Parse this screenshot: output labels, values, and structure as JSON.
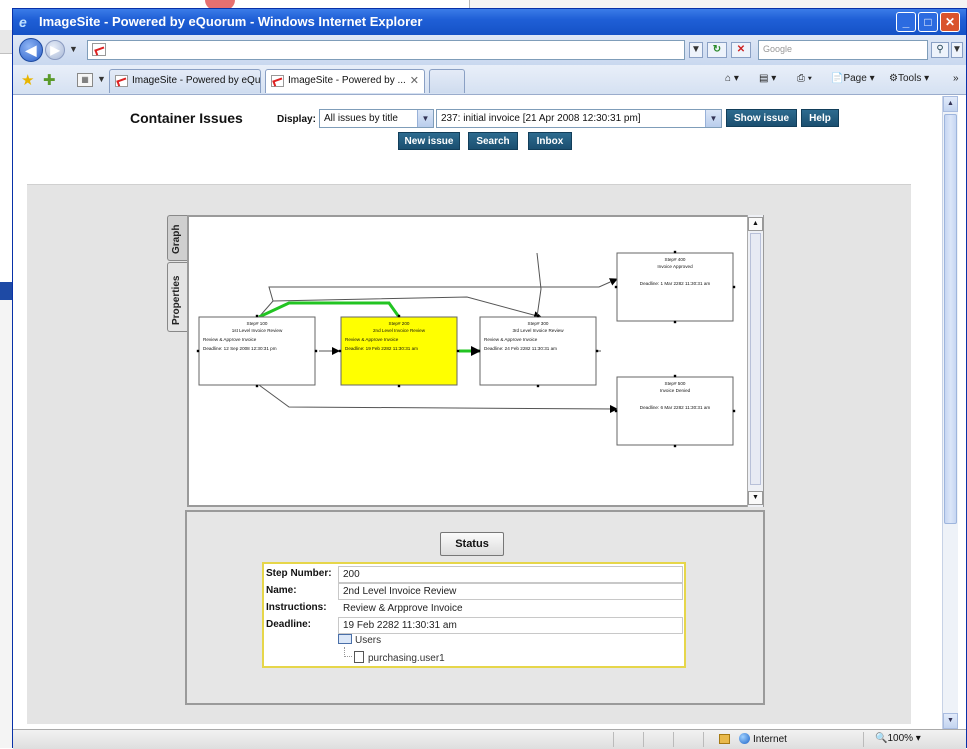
{
  "window": {
    "title": "ImageSite - Powered by eQuorum - Windows Internet Explorer"
  },
  "browser": {
    "search_placeholder": "Google",
    "tabs": [
      {
        "label": "ImageSite - Powered by eQu..."
      },
      {
        "label": "ImageSite - Powered by ..."
      }
    ],
    "tools": {
      "page_label": "Page",
      "tools_label": "Tools"
    }
  },
  "page": {
    "title": "Container Issues",
    "display_label": "Display:",
    "display_select": "All issues by title",
    "issue_select": "237:  initial invoice    [21 Apr 2008 12:30:31 pm]",
    "buttons": {
      "show_issue": "Show issue",
      "help": "Help",
      "new_issue": "New issue",
      "search": "Search",
      "inbox": "Inbox"
    }
  },
  "applet": {
    "tabs": {
      "graph": "Graph",
      "properties": "Properties"
    },
    "nodes": [
      {
        "step": "Step# 100",
        "name": "1st Level Invoice Review",
        "instr": "Review & Approve Invoice",
        "deadline": "Deadline: 12 Sep 2008 12:30:31 pm",
        "highlight": false
      },
      {
        "step": "Step# 200",
        "name": "2nd Level Invoice Review",
        "instr": "Review & Approve Invoice",
        "deadline": "Deadline: 19 Feb 2282 11:30:31 am",
        "highlight": true
      },
      {
        "step": "Step# 300",
        "name": "3rd Level Invoice Review",
        "instr": "Review & Approve Invoice",
        "deadline": "Deadline: 24 Feb 2282 11:30:31 am",
        "highlight": false
      },
      {
        "step": "Step# 400",
        "name": "Invoice Approved",
        "instr": "",
        "deadline": "Deadline: 1 Mar 2282 11:30:31 am",
        "highlight": false
      },
      {
        "step": "Step# 500",
        "name": "Invoice Denied",
        "instr": "",
        "deadline": "Deadline: 6 Mar 2282 11:30:31 am",
        "highlight": false
      }
    ],
    "status": {
      "button": "Status",
      "labels": {
        "step_number": "Step Number:",
        "name": "Name:",
        "instructions": "Instructions:",
        "deadline": "Deadline:"
      },
      "values": {
        "step_number": "200",
        "name": "2nd Level Invoice Review",
        "instructions": "Review & Arpprove Invoice",
        "deadline": "19 Feb 2282 11:30:31 am"
      },
      "tree": {
        "group": "Users",
        "user": "purchasing.user1"
      }
    }
  },
  "statusbar": {
    "zone": "Internet",
    "zoom": "100%"
  },
  "colors": {
    "highlight_node": "#ffff00",
    "active_edge": "#22c422",
    "button_blue": "#1f5578",
    "title_bar": "#1f5fd6"
  }
}
